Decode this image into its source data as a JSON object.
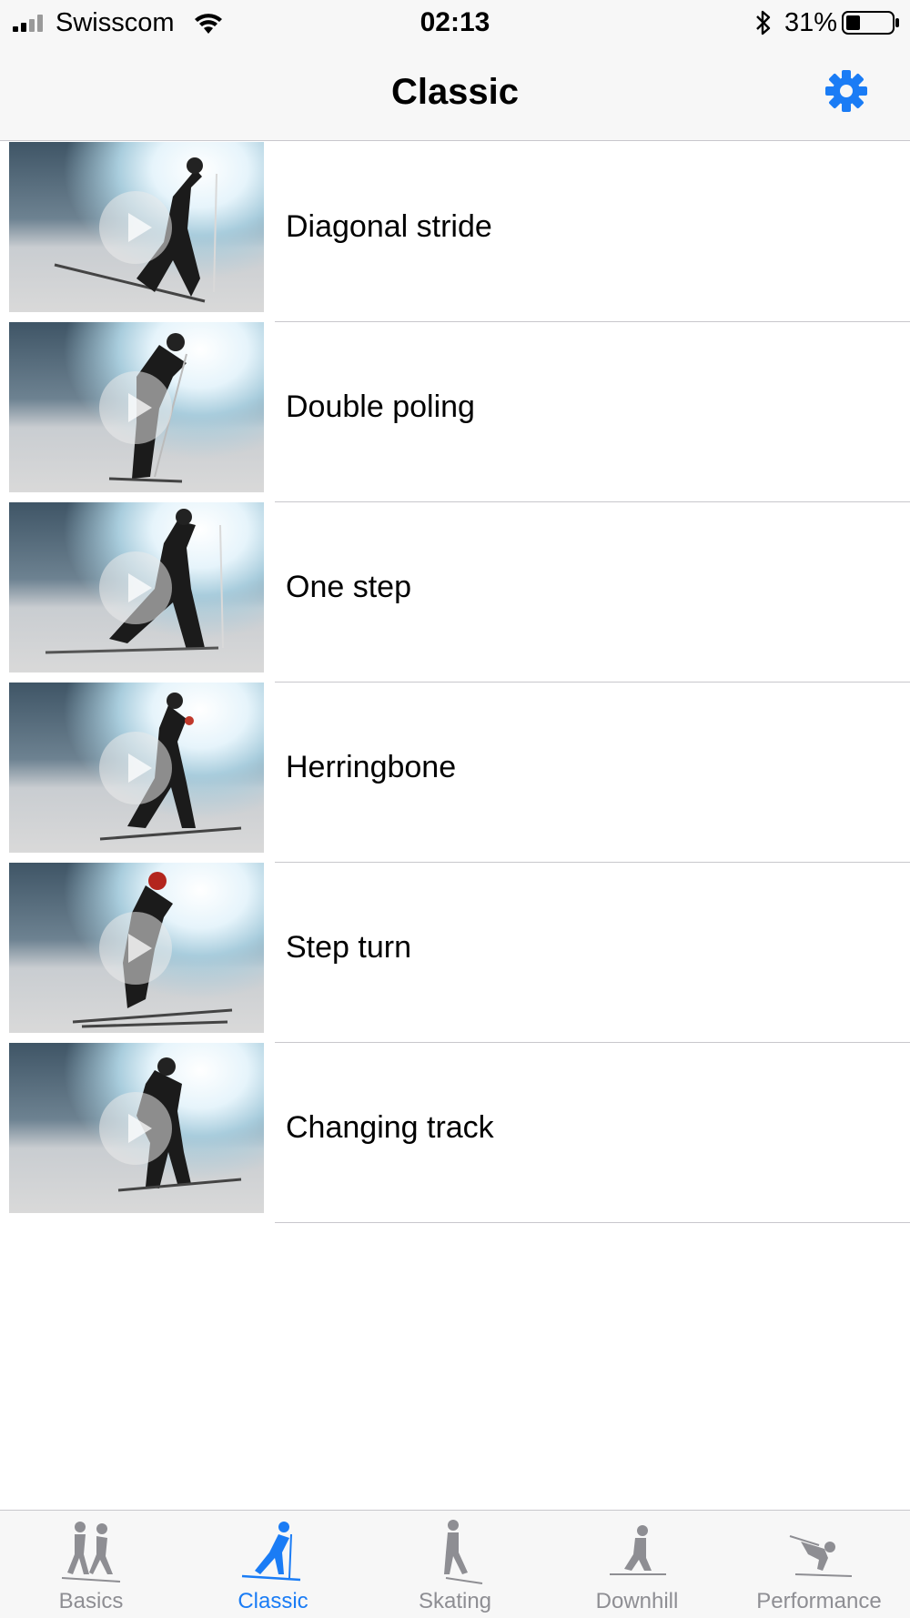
{
  "status_bar": {
    "carrier": "Swisscom",
    "time": "02:13",
    "battery_percent": "31%",
    "battery_level": 0.31,
    "icons": [
      "signal-icon",
      "wifi-icon",
      "bluetooth-icon",
      "battery-icon"
    ]
  },
  "nav": {
    "title": "Classic",
    "settings_icon": "gear-icon",
    "accent_color": "#1a7cf5"
  },
  "techniques": [
    {
      "label": "Diagonal stride"
    },
    {
      "label": "Double poling"
    },
    {
      "label": "One step"
    },
    {
      "label": "Herringbone"
    },
    {
      "label": "Step turn"
    },
    {
      "label": "Changing track"
    }
  ],
  "tabs": [
    {
      "label": "Basics",
      "icon": "skiers-icon",
      "active": false
    },
    {
      "label": "Classic",
      "icon": "classic-skier-icon",
      "active": true
    },
    {
      "label": "Skating",
      "icon": "skating-skier-icon",
      "active": false
    },
    {
      "label": "Downhill",
      "icon": "downhill-skier-icon",
      "active": false
    },
    {
      "label": "Performance",
      "icon": "tuck-skier-icon",
      "active": false
    }
  ]
}
